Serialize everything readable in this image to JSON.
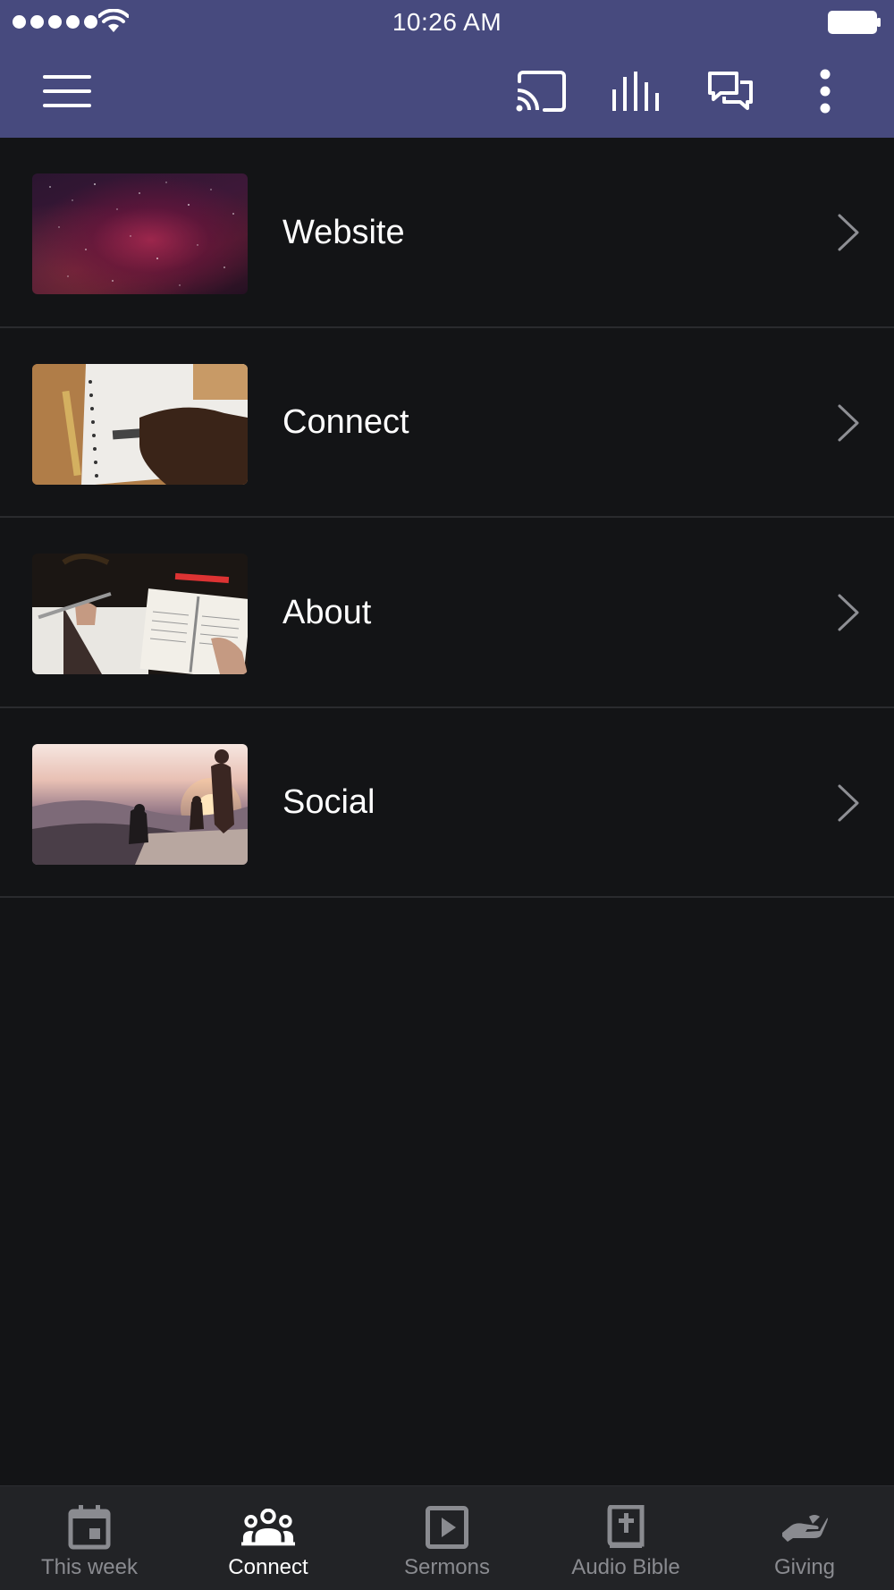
{
  "status_bar": {
    "time": "10:26 AM"
  },
  "app_bar": {
    "icons": [
      "menu-icon",
      "cast-icon",
      "equalizer-icon",
      "chat-icon",
      "more-vertical-icon"
    ]
  },
  "list": {
    "items": [
      {
        "label": "Website",
        "thumbnail": "night-sky-image"
      },
      {
        "label": "Connect",
        "thumbnail": "notebook-writing-image"
      },
      {
        "label": "About",
        "thumbnail": "bible-study-image"
      },
      {
        "label": "Social",
        "thumbnail": "sunset-hikers-image"
      }
    ]
  },
  "tabs": [
    {
      "label": "This week",
      "icon": "calendar-icon",
      "active": false
    },
    {
      "label": "Connect",
      "icon": "people-icon",
      "active": true
    },
    {
      "label": "Sermons",
      "icon": "play-icon",
      "active": false
    },
    {
      "label": "Audio Bible",
      "icon": "bible-icon",
      "active": false
    },
    {
      "label": "Giving",
      "icon": "giving-hand-icon",
      "active": false
    }
  ],
  "colors": {
    "header": "#474a7e",
    "background": "#131416",
    "tabbar": "#222326",
    "active_tab": "#ffffff",
    "inactive_tab": "#8a8b90"
  }
}
